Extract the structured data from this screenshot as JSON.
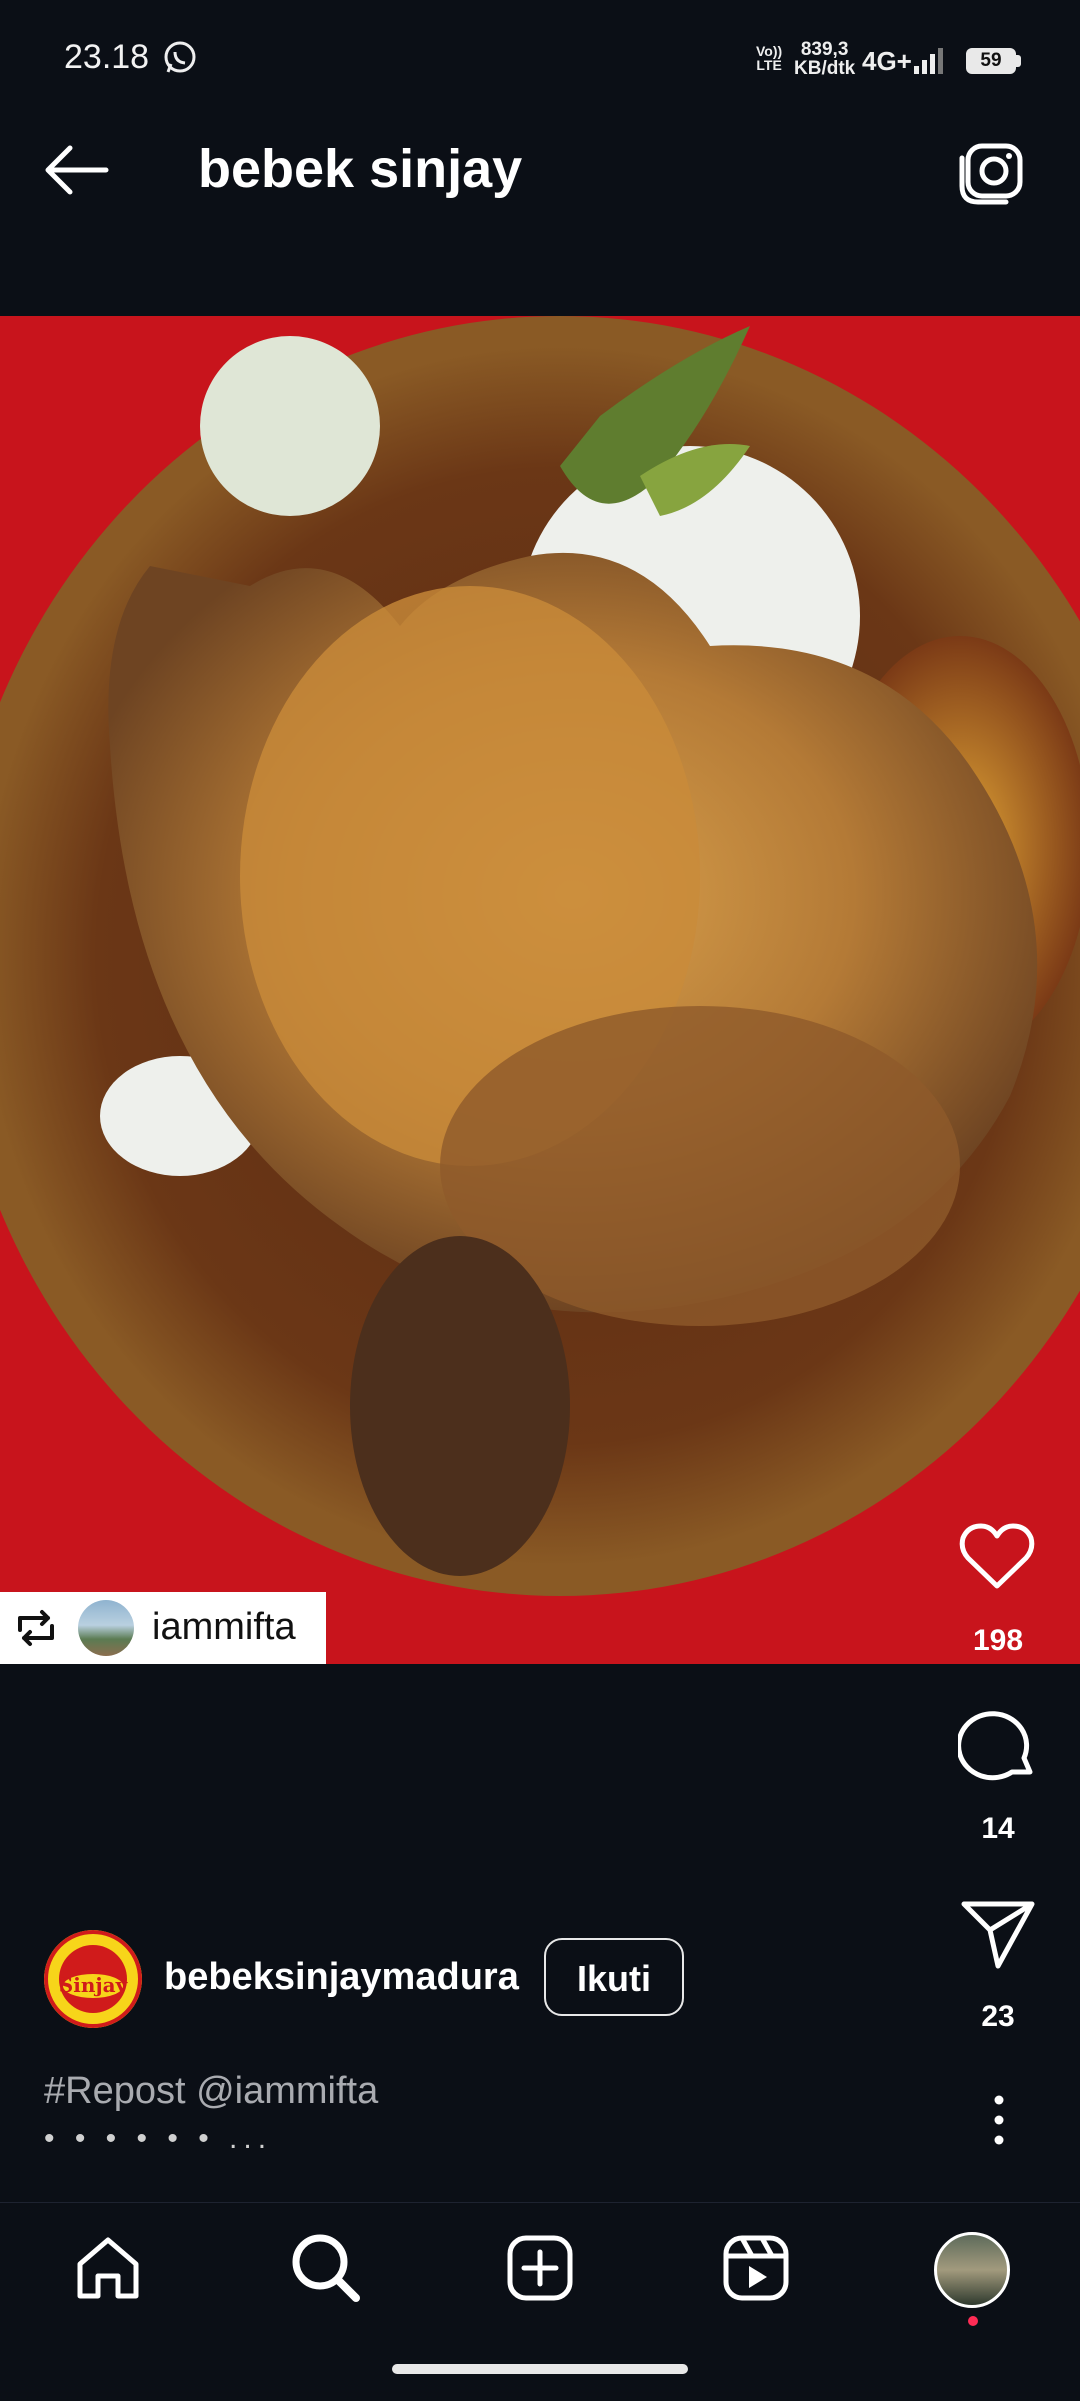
{
  "status_bar": {
    "time": "23.18",
    "volte_top": "Vo))",
    "volte_bottom": "LTE",
    "speed_value": "839,3",
    "speed_unit": "KB/dtk",
    "network": "4G+",
    "battery": "59"
  },
  "header": {
    "title": "bebek sinjay"
  },
  "post": {
    "repost_username": "iammifta",
    "likes": "198",
    "comments": "14",
    "shares": "23",
    "author": "bebeksinjaymadura",
    "follow_label": "Ikuti",
    "caption": "#Repost @iammifta",
    "caption_more": "• • • • • • ..."
  },
  "colors": {
    "background": "#0b0f16",
    "photo_backdrop": "#c8141c",
    "notification_dot": "#ff2c55"
  }
}
